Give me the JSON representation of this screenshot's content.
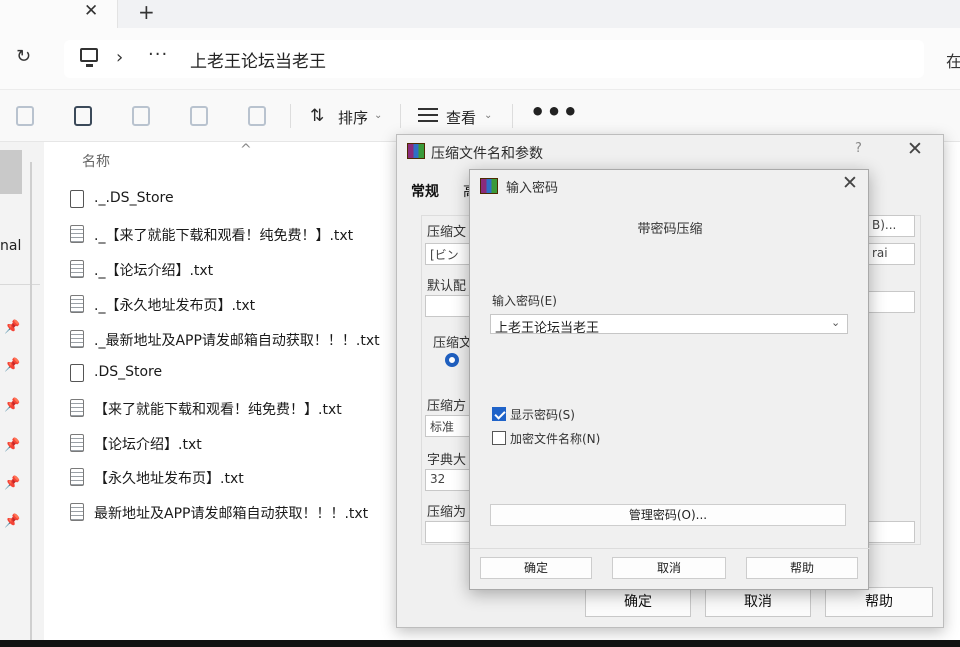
{
  "tab": {
    "close_glyph": "✕",
    "new_tab_glyph": "+"
  },
  "address_bar": {
    "refresh_glyph": "↻",
    "chevron": "›",
    "more": "···",
    "path": "上老王论坛当老王",
    "right_partial": "在"
  },
  "toolbar": {
    "sort_label": "排序",
    "view_label": "查看",
    "more": "•••",
    "caret": "⌄"
  },
  "leftnav": {
    "partial_label": "nal",
    "pin_glyph": "📌"
  },
  "file_list": {
    "column_header": "名称",
    "sort_caret": "^",
    "files": [
      {
        "name": "._.DS_Store",
        "type": "blank"
      },
      {
        "name": "._【来了就能下载和观看！纯免费！】.txt",
        "type": "txt"
      },
      {
        "name": "._【论坛介绍】.txt",
        "type": "txt"
      },
      {
        "name": "._【永久地址发布页】.txt",
        "type": "txt"
      },
      {
        "name": "._最新地址及APP请发邮箱自动获取！！！.txt",
        "type": "txt"
      },
      {
        "name": ".DS_Store",
        "type": "blank"
      },
      {
        "name": "【来了就能下载和观看！纯免费！】.txt",
        "type": "txt"
      },
      {
        "name": "【论坛介绍】.txt",
        "type": "txt"
      },
      {
        "name": "【永久地址发布页】.txt",
        "type": "txt"
      },
      {
        "name": "最新地址及APP请发邮箱自动获取！！！.txt",
        "type": "txt"
      }
    ]
  },
  "back_dialog": {
    "title": "压缩文件名和参数",
    "help": "?",
    "close": "✕",
    "tab_general": "常规",
    "tab_partial": "高",
    "label_archive_name": "压缩文",
    "archive_value": "[ビン",
    "browse_partial": "B)...",
    "format_partial": "rai",
    "label_default": "默认配",
    "label_format": "压缩文",
    "label_method": "压缩方",
    "method_value": "标准",
    "label_dict": "字典大",
    "dict_value": "32",
    "label_split": "压缩为",
    "ok": "确定",
    "cancel": "取消",
    "help_btn": "帮助"
  },
  "front_dialog": {
    "title": "输入密码",
    "close": "✕",
    "heading": "带密码压缩",
    "password_label": "输入密码(E)",
    "password_value": "上老王论坛当老王",
    "combo_caret": "⌄",
    "show_password": {
      "label": "显示密码(S)",
      "checked": true
    },
    "encrypt_names": {
      "label": "加密文件名称(N)",
      "checked": false
    },
    "manage_button": "管理密码(O)...",
    "ok": "确定",
    "cancel": "取消",
    "help": "帮助"
  }
}
